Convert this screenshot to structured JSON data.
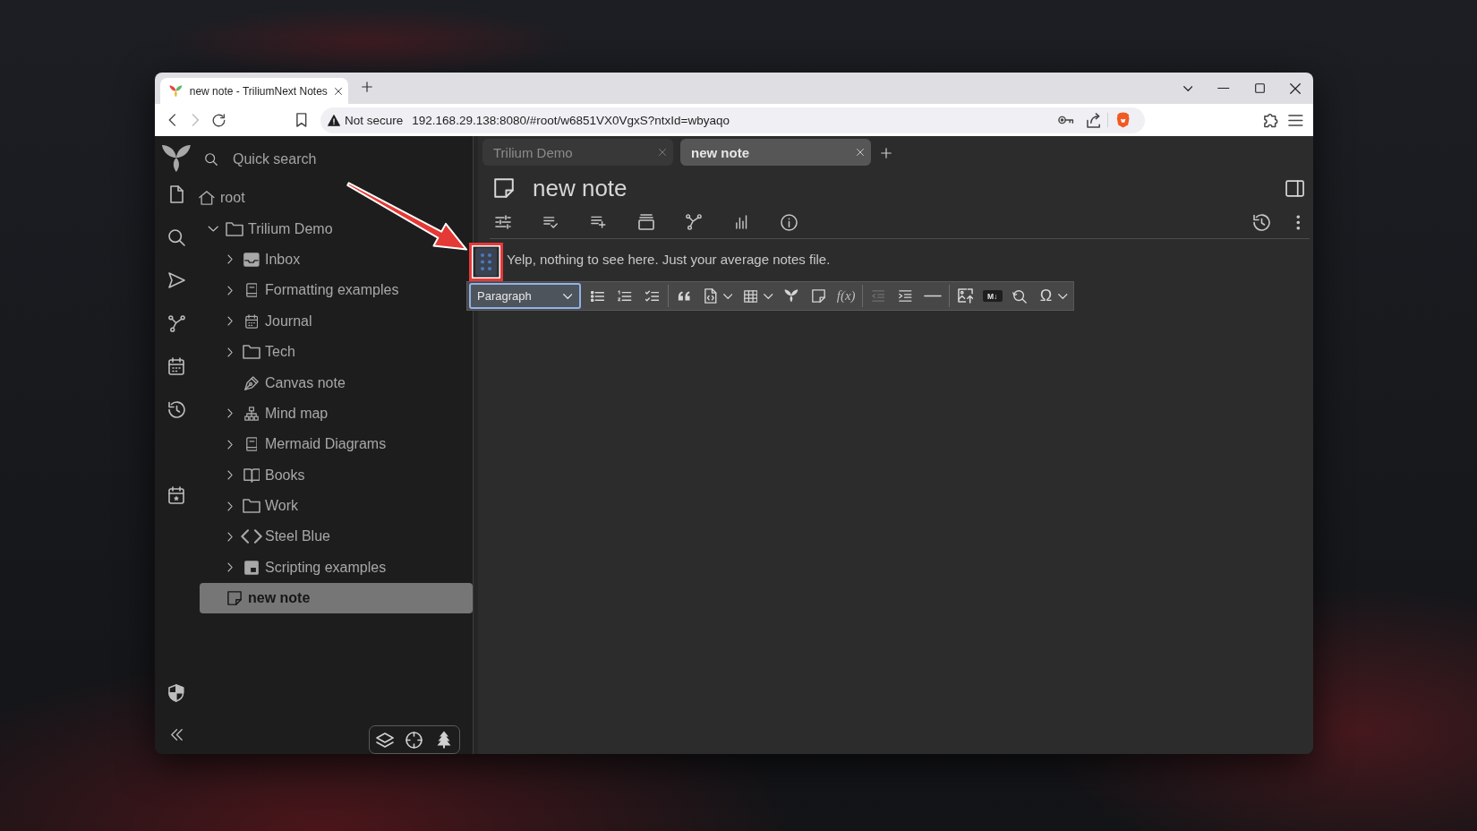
{
  "browser": {
    "tabs": [
      {
        "title": "new note - TriliumNext Notes",
        "selected": true
      }
    ],
    "nav_buttons": [
      {
        "kind": "back",
        "disabled": false
      },
      {
        "kind": "forward",
        "disabled": true
      },
      {
        "kind": "reload",
        "disabled": false
      }
    ],
    "address_bar": {
      "security": "Not secure",
      "url": "192.168.29.138:8080/#root/w6851VX0VgxS?ntxId=wbyaqo"
    }
  },
  "sidebar": {
    "quick_search": {
      "placeholder": "Quick search"
    },
    "tree": {
      "root": {
        "label": "root",
        "kind": "root",
        "selected": false,
        "children": [
          {
            "label": "Trilium Demo",
            "kind": "folder",
            "expanded": true,
            "selected": false,
            "children": [
              {
                "label": "Inbox",
                "kind": "inbox",
                "expanded": false,
                "selected": false
              },
              {
                "label": "Formatting examples",
                "kind": "text",
                "expanded": false,
                "selected": false
              },
              {
                "label": "Journal",
                "kind": "calendar",
                "expanded": false,
                "selected": false
              },
              {
                "label": "Tech",
                "kind": "folder",
                "expanded": false,
                "selected": false
              },
              {
                "label": "Canvas note",
                "kind": "canvas",
                "selected": false
              },
              {
                "label": "Mind map",
                "kind": "mind-map",
                "expanded": false,
                "selected": false
              },
              {
                "label": "Mermaid Diagrams",
                "kind": "text",
                "expanded": false,
                "selected": false
              },
              {
                "label": "Books",
                "kind": "book",
                "expanded": false,
                "selected": false
              },
              {
                "label": "Work",
                "kind": "folder",
                "expanded": false,
                "selected": false
              },
              {
                "label": "Steel Blue",
                "kind": "code",
                "expanded": false,
                "selected": false
              },
              {
                "label": "Scripting examples",
                "kind": "script",
                "expanded": false,
                "selected": false
              }
            ]
          },
          {
            "label": "new note",
            "kind": "note",
            "selected": true
          }
        ]
      }
    }
  },
  "note_tabs": [
    {
      "title": "Trilium Demo",
      "selected": false
    },
    {
      "title": "new note",
      "selected": true
    }
  ],
  "note": {
    "title": "new note",
    "content": "Yelp, nothing to see here. Just your average notes file."
  },
  "format_toolbar": {
    "block_format": "Paragraph",
    "groups": [
      [
        {
          "kind": "bulleted-list",
          "disabled": false,
          "dropdown": false
        },
        {
          "kind": "numbered-list",
          "disabled": false,
          "dropdown": false
        },
        {
          "kind": "todo-list",
          "disabled": false,
          "dropdown": false
        }
      ],
      [
        {
          "kind": "block-quote",
          "disabled": false,
          "dropdown": false
        },
        {
          "kind": "code-block",
          "disabled": false,
          "dropdown": true
        },
        {
          "kind": "table",
          "disabled": false,
          "dropdown": true
        },
        {
          "kind": "note-link",
          "disabled": false,
          "dropdown": false
        },
        {
          "kind": "include-note",
          "disabled": false,
          "dropdown": false
        },
        {
          "kind": "math",
          "label": "f(x)",
          "disabled": false,
          "dropdown": false
        }
      ],
      [
        {
          "kind": "outdent",
          "disabled": true,
          "dropdown": false
        },
        {
          "kind": "indent",
          "disabled": false,
          "dropdown": false
        },
        {
          "kind": "horizontal-line",
          "disabled": false,
          "dropdown": false
        }
      ],
      [
        {
          "kind": "image-upload",
          "disabled": false,
          "dropdown": false
        },
        {
          "kind": "markdown-import",
          "label": "M↓",
          "disabled": false,
          "dropdown": false
        },
        {
          "kind": "find-replace",
          "disabled": false,
          "dropdown": false
        },
        {
          "kind": "special-characters",
          "label": "Ω",
          "disabled": false,
          "dropdown": true
        }
      ]
    ]
  }
}
